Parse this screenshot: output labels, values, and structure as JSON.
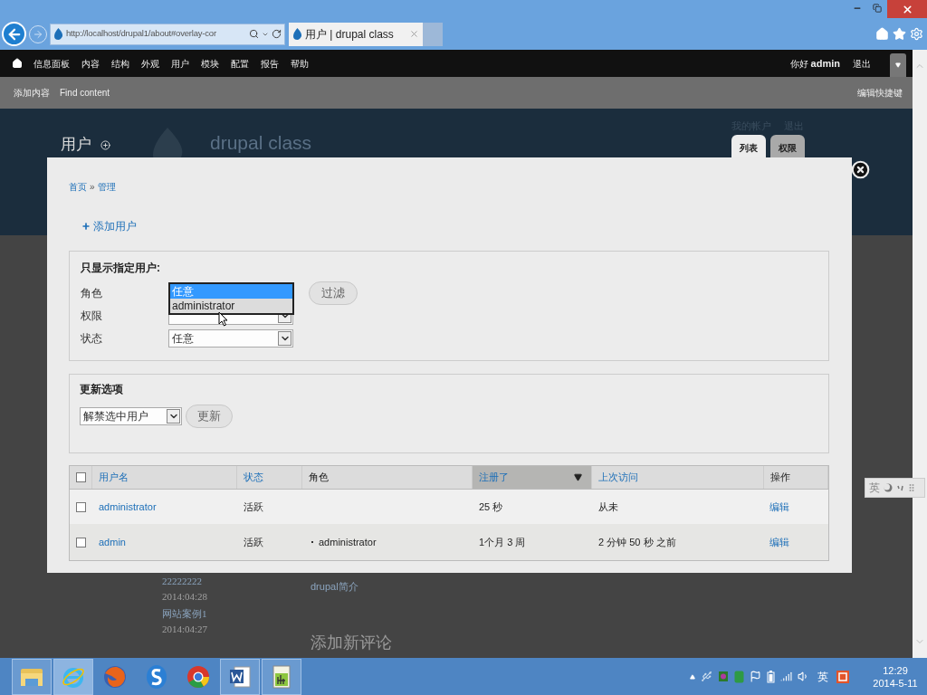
{
  "browser": {
    "address": "http://localhost/drupal1/about#overlay-cor",
    "tab_title": "用户 | drupal class"
  },
  "toolbar": {
    "menu": [
      "信息面板",
      "内容",
      "结构",
      "外观",
      "用户",
      "模块",
      "配置",
      "报告",
      "帮助"
    ],
    "greeting": "你好",
    "user": "admin",
    "logout": "退出"
  },
  "shortcuts": {
    "items": [
      "添加内容",
      "Find content"
    ],
    "edit": "编辑快捷键"
  },
  "page": {
    "title": "用户",
    "site_name": "drupal class",
    "secondary_links": [
      "我的帐户",
      "退出"
    ],
    "tabs": [
      {
        "label": "列表",
        "selected": true
      },
      {
        "label": "权限",
        "selected": false
      }
    ],
    "sidebar": [
      {
        "kind": "link",
        "text": "22222222"
      },
      {
        "kind": "date",
        "text": "2014:04:28"
      },
      {
        "kind": "link",
        "text": "网站案例1"
      },
      {
        "kind": "date",
        "text": "2014:04:27"
      }
    ],
    "content_link": "drupal简介",
    "heading": "添加新评论"
  },
  "overlay": {
    "breadcrumb": [
      "首页",
      "管理"
    ],
    "breadcrumb_separator": "»",
    "add_link": "添加用户",
    "filter": {
      "legend": "只显示指定用户:",
      "button": "过滤",
      "fields": [
        {
          "label": "角色",
          "open": true,
          "options": [
            {
              "label": "任意",
              "selected": true
            },
            {
              "label": "administrator",
              "selected": false
            }
          ]
        },
        {
          "label": "权限",
          "open": false
        },
        {
          "label": "状态",
          "open": false,
          "value": "任意"
        }
      ]
    },
    "update": {
      "legend": "更新选项",
      "value": "解禁选中用户",
      "button": "更新"
    },
    "table": {
      "all_checked": false,
      "columns": [
        {
          "label": "用户名",
          "link": true,
          "sorted": false
        },
        {
          "label": "状态",
          "link": true,
          "sorted": false
        },
        {
          "label": "角色",
          "link": false,
          "sorted": false
        },
        {
          "label": "注册了",
          "link": true,
          "sorted": true
        },
        {
          "label": "上次访问",
          "link": true,
          "sorted": false
        },
        {
          "label": "操作",
          "link": false,
          "sorted": false
        }
      ],
      "rows": [
        {
          "checked": false,
          "username": "administrator",
          "status": "活跃",
          "roles": [],
          "registered": "25 秒",
          "last_access": "从未",
          "operation": "编辑"
        },
        {
          "checked": false,
          "username": "admin",
          "status": "活跃",
          "roles": [
            "administrator"
          ],
          "registered": "1个月 3 周",
          "last_access": "2 分钟 50 秒 之前",
          "operation": "编辑"
        }
      ]
    }
  },
  "ime_bar": {
    "label": "英"
  },
  "taskbar": {
    "apps": [
      {
        "kind": "folder",
        "active": false,
        "running": true
      },
      {
        "kind": "ie",
        "active": true,
        "running": true
      },
      {
        "kind": "firefox",
        "active": false,
        "running": false
      },
      {
        "kind": "sogou",
        "active": false,
        "running": false
      },
      {
        "kind": "chrome",
        "active": false,
        "running": false
      },
      {
        "kind": "word",
        "active": false,
        "running": true
      },
      {
        "kind": "chartdoc",
        "active": false,
        "running": true
      }
    ],
    "ime": "英",
    "time": "12:29",
    "date": "2014-5-11"
  }
}
